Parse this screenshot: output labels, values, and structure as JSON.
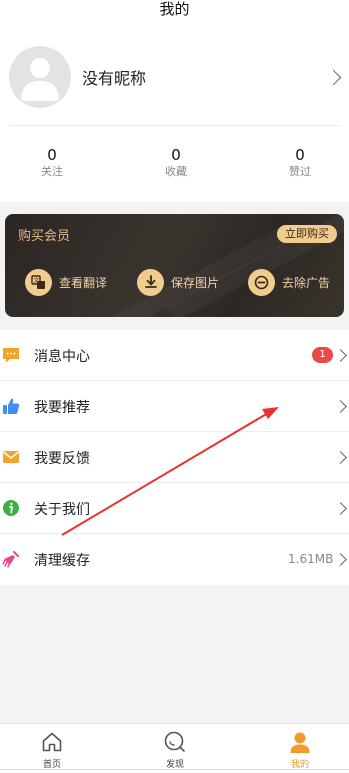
{
  "header": {
    "title": "我的"
  },
  "profile": {
    "nickname": "没有昵称",
    "stats": [
      {
        "value": "0",
        "label": "关注"
      },
      {
        "value": "0",
        "label": "收藏"
      },
      {
        "value": "0",
        "label": "赞过"
      }
    ]
  },
  "vip": {
    "title": "购买会员",
    "buy_label": "立即购买",
    "features": [
      {
        "label": "查看翻译",
        "icon": "translate-icon"
      },
      {
        "label": "保存图片",
        "icon": "download-icon"
      },
      {
        "label": "去除广告",
        "icon": "no-ads-icon"
      }
    ]
  },
  "menu": {
    "items": [
      {
        "label": "消息中心",
        "icon": "message-icon",
        "badge": "1"
      },
      {
        "label": "我要推荐",
        "icon": "thumbs-up-icon"
      },
      {
        "label": "我要反馈",
        "icon": "envelope-icon"
      },
      {
        "label": "关于我们",
        "icon": "info-icon"
      },
      {
        "label": "清理缓存",
        "icon": "broom-icon",
        "value": "1.61MB"
      }
    ]
  },
  "tabbar": {
    "items": [
      {
        "label": "首页",
        "icon": "home-icon"
      },
      {
        "label": "发现",
        "icon": "discover-icon"
      },
      {
        "label": "我的",
        "icon": "profile-icon",
        "active": true
      }
    ]
  },
  "colors": {
    "accent": "#f39a2a",
    "vip_gold": "#f1cc8e",
    "badge_red": "#e84a49",
    "annotation_red": "#e8322f"
  }
}
